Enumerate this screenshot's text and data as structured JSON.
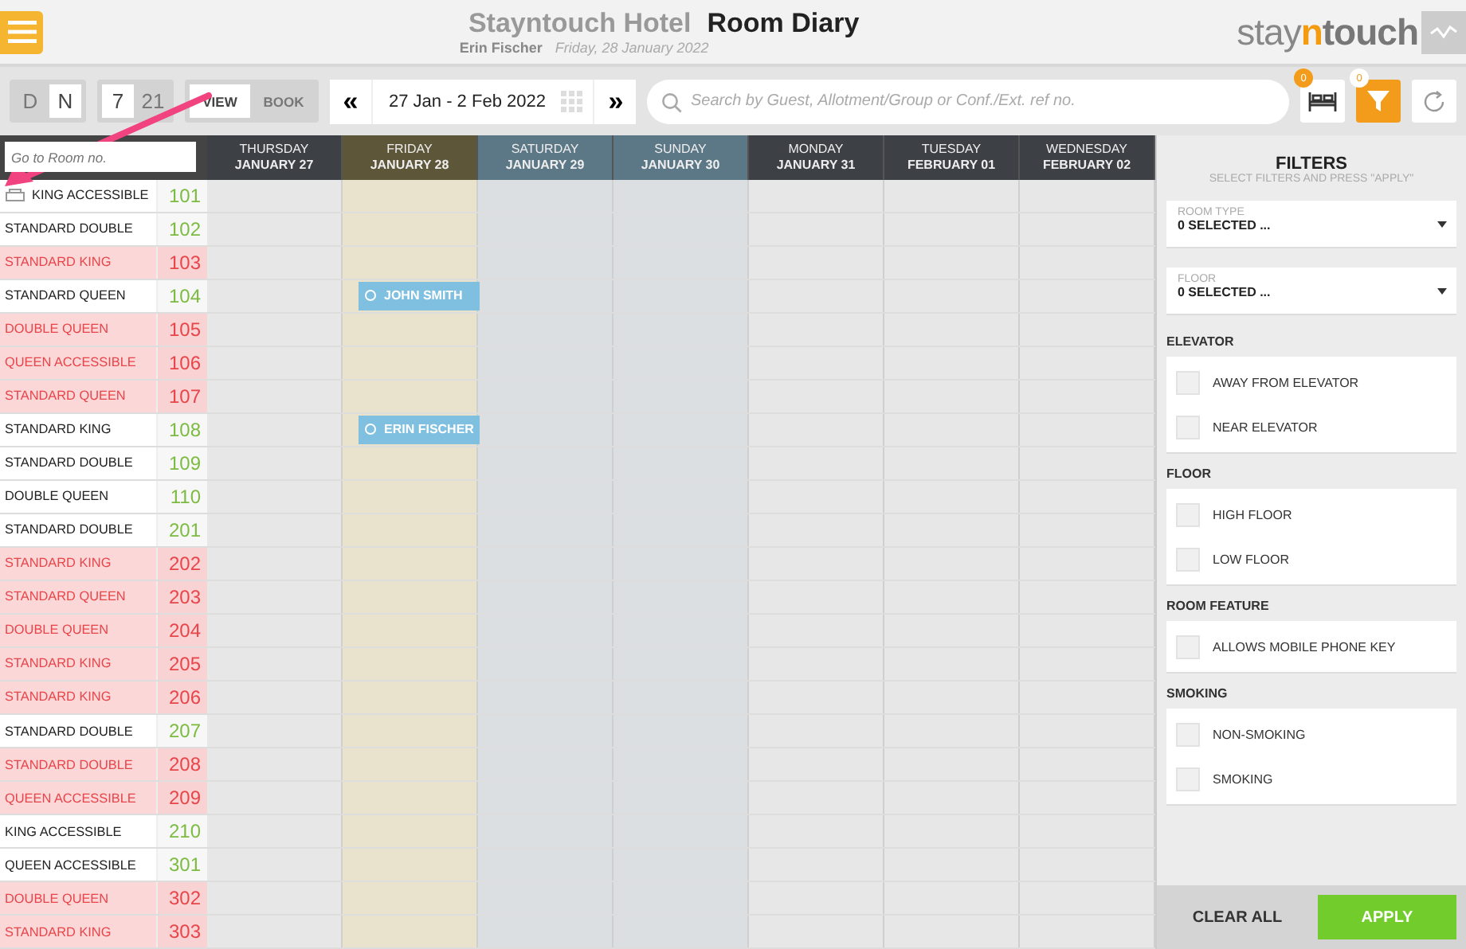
{
  "header": {
    "hotel": "Stayntouch Hotel",
    "title": "Room Diary",
    "user": "Erin Fischer",
    "date": "Friday, 28 January 2022",
    "logo": {
      "before": "stay",
      "accent": "n",
      "after": "touch"
    }
  },
  "toolbar": {
    "shift": [
      {
        "label": "D",
        "selected": false
      },
      {
        "label": "N",
        "selected": true
      }
    ],
    "range": [
      {
        "label": "7",
        "selected": true
      },
      {
        "label": "21",
        "selected": false
      }
    ],
    "mode": [
      {
        "label": "VIEW",
        "selected": true
      },
      {
        "label": "BOOK",
        "selected": false
      }
    ],
    "prev": "«",
    "dates": "27 Jan - 2 Feb 2022",
    "next": "»",
    "search": {
      "placeholder": "Search by Guest, Allotment/Group or Conf./Ext. ref no."
    },
    "rooms_badge": "0",
    "filter_badge": "0",
    "filter_active": true
  },
  "goto": {
    "placeholder": "Go to Room no."
  },
  "days": [
    {
      "weekday": "THURSDAY",
      "date": "JANUARY 27",
      "kind": "weekday"
    },
    {
      "weekday": "FRIDAY",
      "date": "JANUARY 28",
      "kind": "today"
    },
    {
      "weekday": "SATURDAY",
      "date": "JANUARY 29",
      "kind": "weekend"
    },
    {
      "weekday": "SUNDAY",
      "date": "JANUARY 30",
      "kind": "weekend"
    },
    {
      "weekday": "MONDAY",
      "date": "JANUARY 31",
      "kind": "weekday"
    },
    {
      "weekday": "TUESDAY",
      "date": "FEBRUARY 01",
      "kind": "weekday"
    },
    {
      "weekday": "WEDNESDAY",
      "date": "FEBRUARY 02",
      "kind": "weekday"
    }
  ],
  "rooms": [
    {
      "type": "KING ACCESSIBLE",
      "number": "101",
      "dirty": false,
      "flagged": true
    },
    {
      "type": "STANDARD DOUBLE",
      "number": "102",
      "dirty": false,
      "flagged": false
    },
    {
      "type": "STANDARD KING",
      "number": "103",
      "dirty": true,
      "flagged": false
    },
    {
      "type": "STANDARD QUEEN",
      "number": "104",
      "dirty": false,
      "flagged": false,
      "booking": {
        "guest": "JOHN SMITH"
      }
    },
    {
      "type": "DOUBLE QUEEN",
      "number": "105",
      "dirty": true,
      "flagged": false
    },
    {
      "type": "QUEEN ACCESSIBLE",
      "number": "106",
      "dirty": true,
      "flagged": false
    },
    {
      "type": "STANDARD QUEEN",
      "number": "107",
      "dirty": true,
      "flagged": false
    },
    {
      "type": "STANDARD KING",
      "number": "108",
      "dirty": false,
      "flagged": false,
      "booking": {
        "guest": "ERIN FISCHER"
      }
    },
    {
      "type": "STANDARD DOUBLE",
      "number": "109",
      "dirty": false,
      "flagged": false
    },
    {
      "type": "DOUBLE QUEEN",
      "number": "110",
      "dirty": false,
      "flagged": false
    },
    {
      "type": "STANDARD DOUBLE",
      "number": "201",
      "dirty": false,
      "flagged": false
    },
    {
      "type": "STANDARD KING",
      "number": "202",
      "dirty": true,
      "flagged": false
    },
    {
      "type": "STANDARD QUEEN",
      "number": "203",
      "dirty": true,
      "flagged": false
    },
    {
      "type": "DOUBLE QUEEN",
      "number": "204",
      "dirty": true,
      "flagged": false
    },
    {
      "type": "STANDARD KING",
      "number": "205",
      "dirty": true,
      "flagged": false
    },
    {
      "type": "STANDARD KING",
      "number": "206",
      "dirty": true,
      "flagged": false
    },
    {
      "type": "STANDARD DOUBLE",
      "number": "207",
      "dirty": false,
      "flagged": false
    },
    {
      "type": "STANDARD DOUBLE",
      "number": "208",
      "dirty": true,
      "flagged": false
    },
    {
      "type": "QUEEN ACCESSIBLE",
      "number": "209",
      "dirty": true,
      "flagged": false
    },
    {
      "type": "KING ACCESSIBLE",
      "number": "210",
      "dirty": false,
      "flagged": false
    },
    {
      "type": "QUEEN ACCESSIBLE",
      "number": "301",
      "dirty": false,
      "flagged": false
    },
    {
      "type": "DOUBLE QUEEN",
      "number": "302",
      "dirty": true,
      "flagged": false
    },
    {
      "type": "STANDARD KING",
      "number": "303",
      "dirty": true,
      "flagged": false
    }
  ],
  "filters": {
    "title": "FILTERS",
    "subtitle": "SELECT FILTERS AND PRESS \"APPLY\"",
    "dropdowns": [
      {
        "label": "ROOM TYPE",
        "value": "0 SELECTED ..."
      },
      {
        "label": "FLOOR",
        "value": "0 SELECTED ..."
      }
    ],
    "sections": [
      {
        "title": "ELEVATOR",
        "options": [
          {
            "label": "AWAY FROM ELEVATOR",
            "checked": false
          },
          {
            "label": "NEAR ELEVATOR",
            "checked": false
          }
        ]
      },
      {
        "title": "FLOOR",
        "options": [
          {
            "label": "HIGH FLOOR",
            "checked": false
          },
          {
            "label": "LOW FLOOR",
            "checked": false
          }
        ]
      },
      {
        "title": "ROOM FEATURE",
        "options": [
          {
            "label": "ALLOWS MOBILE PHONE KEY",
            "checked": false
          }
        ]
      },
      {
        "title": "SMOKING",
        "options": [
          {
            "label": "NON-SMOKING",
            "checked": false
          },
          {
            "label": "SMOKING",
            "checked": false
          }
        ]
      }
    ],
    "clear": "CLEAR ALL",
    "apply": "APPLY"
  }
}
